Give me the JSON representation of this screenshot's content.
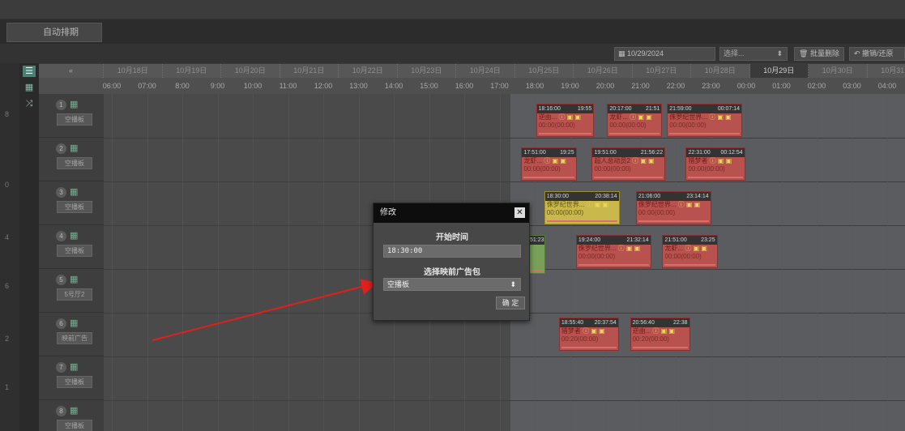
{
  "toolbar": {
    "auto_schedule_tab": "自动排期",
    "date_value": "10/29/2024",
    "select_placeholder": "选择...",
    "batch_delete": "批量删除",
    "undo_label": "撤销/还原"
  },
  "left_edge": [
    "8",
    "0",
    "4",
    "6",
    "2",
    "1"
  ],
  "header": {
    "dates": [
      "10月18日",
      "10月19日",
      "10月20日",
      "10月21日",
      "10月22日",
      "10月23日",
      "10月24日",
      "10月25日",
      "10月26日",
      "10月27日",
      "10月28日",
      "10月29日",
      "10月30日",
      "10月31日"
    ],
    "collapse_label": "«",
    "times": [
      "06:00",
      "07:00",
      "8:00",
      "9:00",
      "10:00",
      "11:00",
      "12:00",
      "13:00",
      "14:00",
      "15:00",
      "16:00",
      "17:00",
      "18:00",
      "19:00",
      "20:00",
      "21:00",
      "22:00",
      "23:00",
      "00:00",
      "01:00",
      "02:00",
      "03:00",
      "04:00"
    ]
  },
  "rows": [
    {
      "num": "1",
      "tag": "空播板"
    },
    {
      "num": "2",
      "tag": "空播板"
    },
    {
      "num": "3",
      "tag": "空播板"
    },
    {
      "num": "4",
      "tag": "空播板"
    },
    {
      "num": "5",
      "tag": "5号厅2"
    },
    {
      "num": "6",
      "tag": "映前广告"
    },
    {
      "num": "7",
      "tag": "空播板"
    },
    {
      "num": "8",
      "tag": "空播板"
    }
  ],
  "blocks": [
    {
      "start": "18:16:00",
      "end": "19:55",
      "title": "逆由...",
      "dur": "00:00(00:00)",
      "color": "red"
    },
    {
      "start": "20:17:00",
      "end": "21:51",
      "title": "龙虾...",
      "dur": "00:00(00:00)",
      "color": "red"
    },
    {
      "start": "21:59:00",
      "end": "00:07:14",
      "title": "侏罗纪世界...",
      "dur": "00:00(00:00)",
      "color": "red"
    },
    {
      "start": "17:51:00",
      "end": "19:25",
      "title": "龙虾...",
      "dur": "00:00(00:00)",
      "color": "red"
    },
    {
      "start": "19:51:00",
      "end": "21:56:22",
      "title": "超人总动员2",
      "dur": "00:00(00:00)",
      "color": "red"
    },
    {
      "start": "22:31:00",
      "end": "00:12:54",
      "title": "猎梦者",
      "dur": "00:00(00:00)",
      "color": "red"
    },
    {
      "start": "18:30:00",
      "end": "20:38:14",
      "title": "侏罗纪世界...",
      "dur": "00:00(00:00)",
      "color": "yellow"
    },
    {
      "start": "21:06:00",
      "end": "23:14:14",
      "title": "侏罗纪世界...",
      "dur": "00:00(00:00)",
      "color": "red"
    },
    {
      "start": "",
      "end": "51:23",
      "title": "",
      "dur": "",
      "color": "green"
    },
    {
      "start": "19:24:00",
      "end": "21:32:14",
      "title": "侏罗纪世界...",
      "dur": "00:00(00:00)",
      "color": "red"
    },
    {
      "start": "21:51:00",
      "end": "23:25",
      "title": "龙虾...",
      "dur": "00:00(00:00)",
      "color": "red"
    },
    {
      "start": "18:55:40",
      "end": "20:37:54",
      "title": "猎梦者",
      "dur": "00:20(00:00)",
      "color": "red"
    },
    {
      "start": "20:56:40",
      "end": "22:38",
      "title": "逆由...",
      "dur": "00:20(00:00)",
      "color": "red"
    }
  ],
  "modal": {
    "title": "修改",
    "close": "✕",
    "start_time_label": "开始时间",
    "start_time_value": "18:30:00",
    "ad_package_label": "选择映前广告包",
    "ad_package_value": "空播板",
    "confirm": "确 定"
  },
  "colors": {
    "accent_red": "#b8524e",
    "accent_yellow": "#c9b84b",
    "annotation_arrow": "#e0201a"
  }
}
